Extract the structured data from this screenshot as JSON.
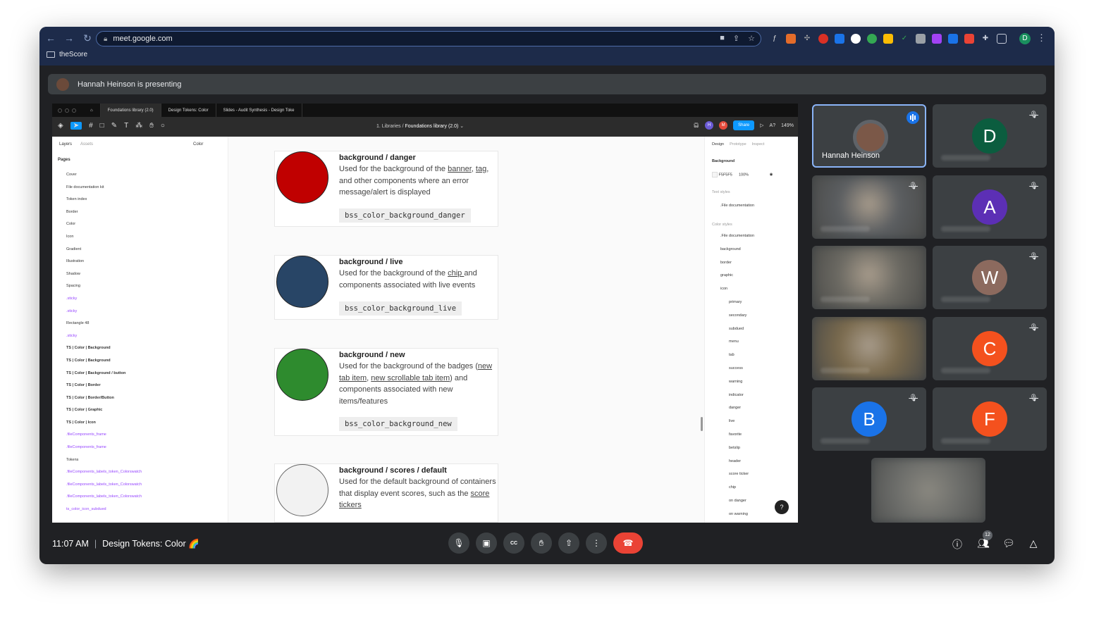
{
  "browser": {
    "url": "meet.google.com",
    "bookmark": "theScore",
    "profile_initial": "D"
  },
  "presenting": {
    "banner": "Hannah Heinson is presenting"
  },
  "figma": {
    "tabs": [
      "Foundations library (2.0)",
      "Design Tokens: Color",
      "Slides - Audit Synthesis - Design Toke"
    ],
    "breadcrumb_parent": "1. Libraries",
    "breadcrumb_file": "Foundations library (2.0)",
    "share_label": "Share",
    "zoom": "149%",
    "left_tabs": {
      "layers": "Layers",
      "assets": "Assets",
      "page_select": "Color"
    },
    "pages_header": "Pages",
    "pages": [
      "Cover",
      "File documentation kit",
      "Token index",
      "Border",
      "Color",
      "Icon",
      "Gradient",
      "Illustration",
      "Shadow",
      "Spacing"
    ],
    "layers": [
      ".sticky",
      ".sticky",
      "Rectangle 48",
      ".sticky",
      "TS | Color | Background",
      "TS | Color | Background",
      "TS | Color | Background / button",
      "TS | Color | Border",
      "TS | Color | Border/Button",
      "TS | Color | Graphic",
      "TS | Color | Icon",
      ".fileComponents_frame",
      ".fileComponents_frame",
      "Tokens",
      ".fileComponents_labels_token_Colorswatch",
      ".fileComponents_labels_token_Colorswatch",
      ".fileComponents_labels_token_Colorswatch",
      "ts_color_icon_subdued"
    ],
    "right_tabs": [
      "Design",
      "Prototype",
      "Inspect"
    ],
    "background_label": "Background",
    "background_hex": "F5F5F5",
    "background_opacity": "100%",
    "text_styles_label": "Text styles",
    "text_style_item": ".File documentation",
    "color_styles_label": "Color styles",
    "color_styles": [
      ".File documentation",
      "background",
      "border",
      "graphic",
      "icon"
    ],
    "icon_styles": [
      "primary",
      "secondary",
      "subdued",
      "menu",
      "tab",
      "success",
      "warning",
      "indicator",
      "danger",
      "live",
      "favorite",
      "betslip",
      "header",
      "score ticker",
      "chip",
      "on danger",
      "on warning"
    ],
    "cards": [
      {
        "title": "background / danger",
        "desc_a": "Used for the background of the ",
        "link1": "banner",
        "desc_b": ", ",
        "link2": "tag",
        "desc_c": ", and other components where an error message/alert is displayed",
        "token": "bss_color_background_danger",
        "color": "#c00000"
      },
      {
        "title": "background / live",
        "desc_a": "Used for the background of the ",
        "link1": "chip ",
        "desc_b": "and components associated with live events",
        "token": "bss_color_background_live",
        "color": "#284566"
      },
      {
        "title": "background / new",
        "desc_a": "Used for the background of the badges (",
        "link1": "new tab item",
        "desc_b": ", ",
        "link2": "new scrollable tab item",
        "desc_c": ") and components associated with new items/features",
        "token": "bss_color_background_new",
        "color": "#2e8b2e"
      },
      {
        "title": "background / scores / default",
        "desc_a": "Used for the default background of containers that display event scores, such as the ",
        "link1": "score tickers",
        "color": "#f2f2f2"
      }
    ],
    "help_label": "?"
  },
  "participants": [
    {
      "name": "Hannah Heinson",
      "initial": "",
      "color": "#3c4043",
      "speaking": true
    },
    {
      "name": "",
      "initial": "D",
      "color": "#0b5d3f",
      "muted": true
    },
    {
      "name": "",
      "initial": "",
      "color": "#5b5e61",
      "muted": true
    },
    {
      "name": "",
      "initial": "A",
      "color": "#5c2fb5",
      "muted": true
    },
    {
      "name": "",
      "initial": "",
      "color": "#6c6a63"
    },
    {
      "name": "",
      "initial": "W",
      "color": "#8c6a5e",
      "muted": true
    },
    {
      "name": "",
      "initial": "",
      "color": "#7a6a4d"
    },
    {
      "name": "",
      "initial": "C",
      "color": "#f4511e",
      "muted": true
    },
    {
      "name": "",
      "initial": "B",
      "color": "#1a73e8",
      "muted": true
    },
    {
      "name": "",
      "initial": "F",
      "color": "#f4511e",
      "muted": true
    }
  ],
  "bottom_bar": {
    "time": "11:07 AM",
    "meeting_title": "Design Tokens: Color 🌈",
    "people_count": "12"
  }
}
